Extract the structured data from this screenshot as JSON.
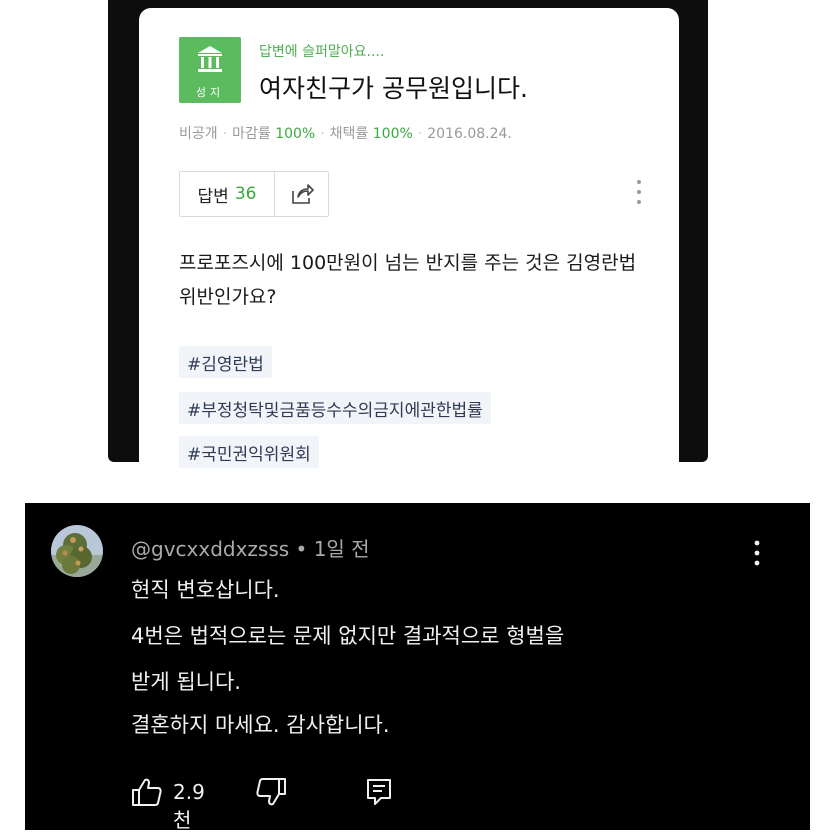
{
  "question": {
    "badge_label": "성지",
    "subtitle": "답변에 슬퍼말아요....",
    "title": "여자친구가 공무원입니다.",
    "meta": {
      "visibility": "비공개",
      "deadline_label": "마감률",
      "deadline_rate": "100%",
      "adopt_label": "채택률",
      "adopt_rate": "100%",
      "date": "2016.08.24."
    },
    "answer_label": "답변",
    "answer_count": "36",
    "body": "프로포즈시에 100만원이 넘는 반지를 주는 것은 김영란법 위반인가요?",
    "tags": [
      "#김영란법",
      "#부정청탁및금품등수수의금지에관한법률",
      "#국민권익위원회"
    ]
  },
  "comment": {
    "author": "@gvcxxddxzsss",
    "time": "1일 전",
    "lines": [
      "현직 변호삽니다.",
      "4번은 법적으로는 문제 없지만 결과적으로 형벌을",
      "받게 됩니다.",
      "결혼하지 마세요. 감사합니다."
    ],
    "likes": "2.9천"
  },
  "icons": {
    "badge": "building-icon",
    "share": "share-icon",
    "question_more": "more-vertical-icon",
    "comment_more": "more-vertical-icon",
    "like": "thumbs-up-icon",
    "dislike": "thumbs-down-icon",
    "reply": "reply-icon"
  },
  "colors": {
    "badge_green": "#5cbb5f",
    "accent_green": "#3aa93f",
    "tag_bg": "#f1f4f9",
    "comment_bg": "#000000"
  }
}
